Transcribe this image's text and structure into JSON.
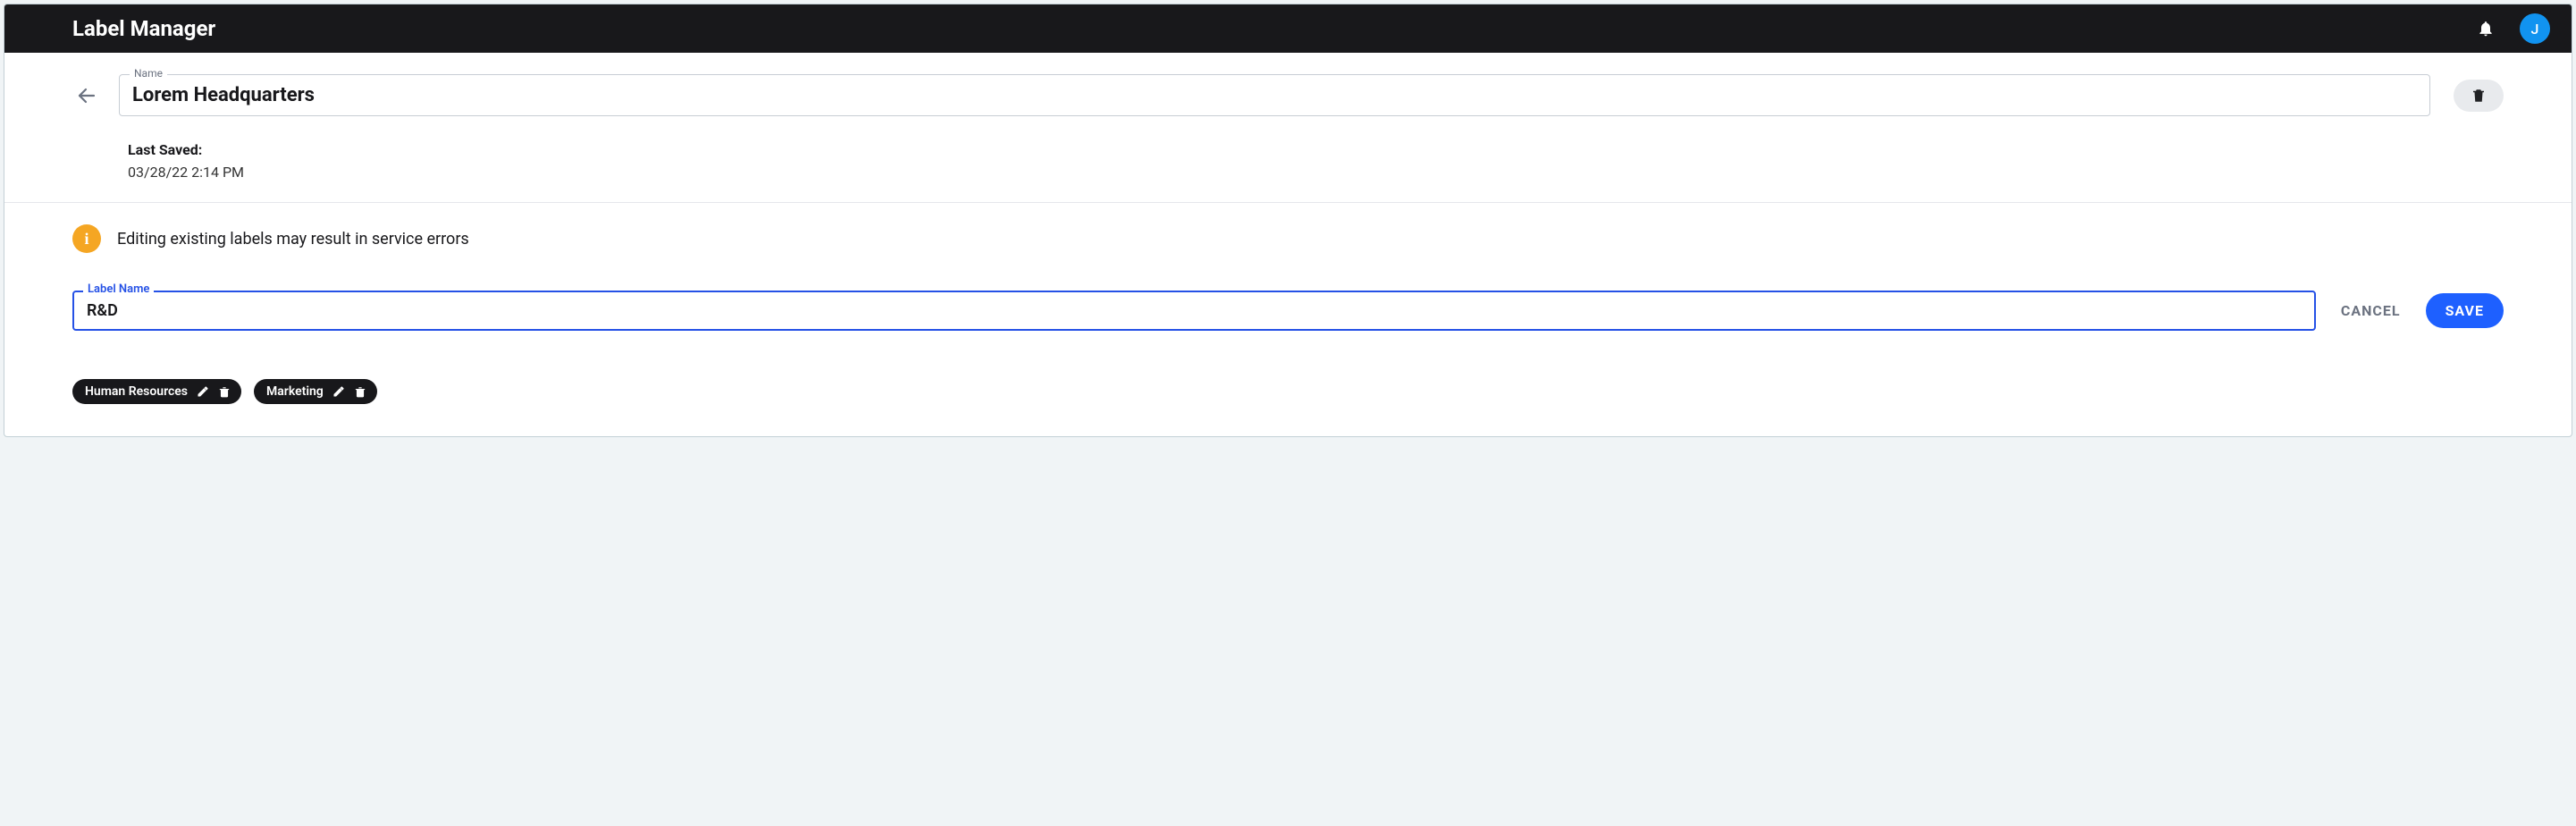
{
  "app": {
    "title": "Label Manager",
    "avatar_letter": "J"
  },
  "header": {
    "name_field_label": "Name",
    "name_value": "Lorem Headquarters",
    "last_saved_label": "Last Saved:",
    "last_saved_value": "03/28/22 2:14 PM"
  },
  "body": {
    "warning_icon": "i",
    "warning_text": "Editing existing labels may result in service errors",
    "label_field_label": "Label Name",
    "label_field_value": "R&D",
    "cancel_label": "CANCEL",
    "save_label": "SAVE",
    "chips": [
      {
        "text": "Human Resources"
      },
      {
        "text": "Marketing"
      }
    ]
  }
}
